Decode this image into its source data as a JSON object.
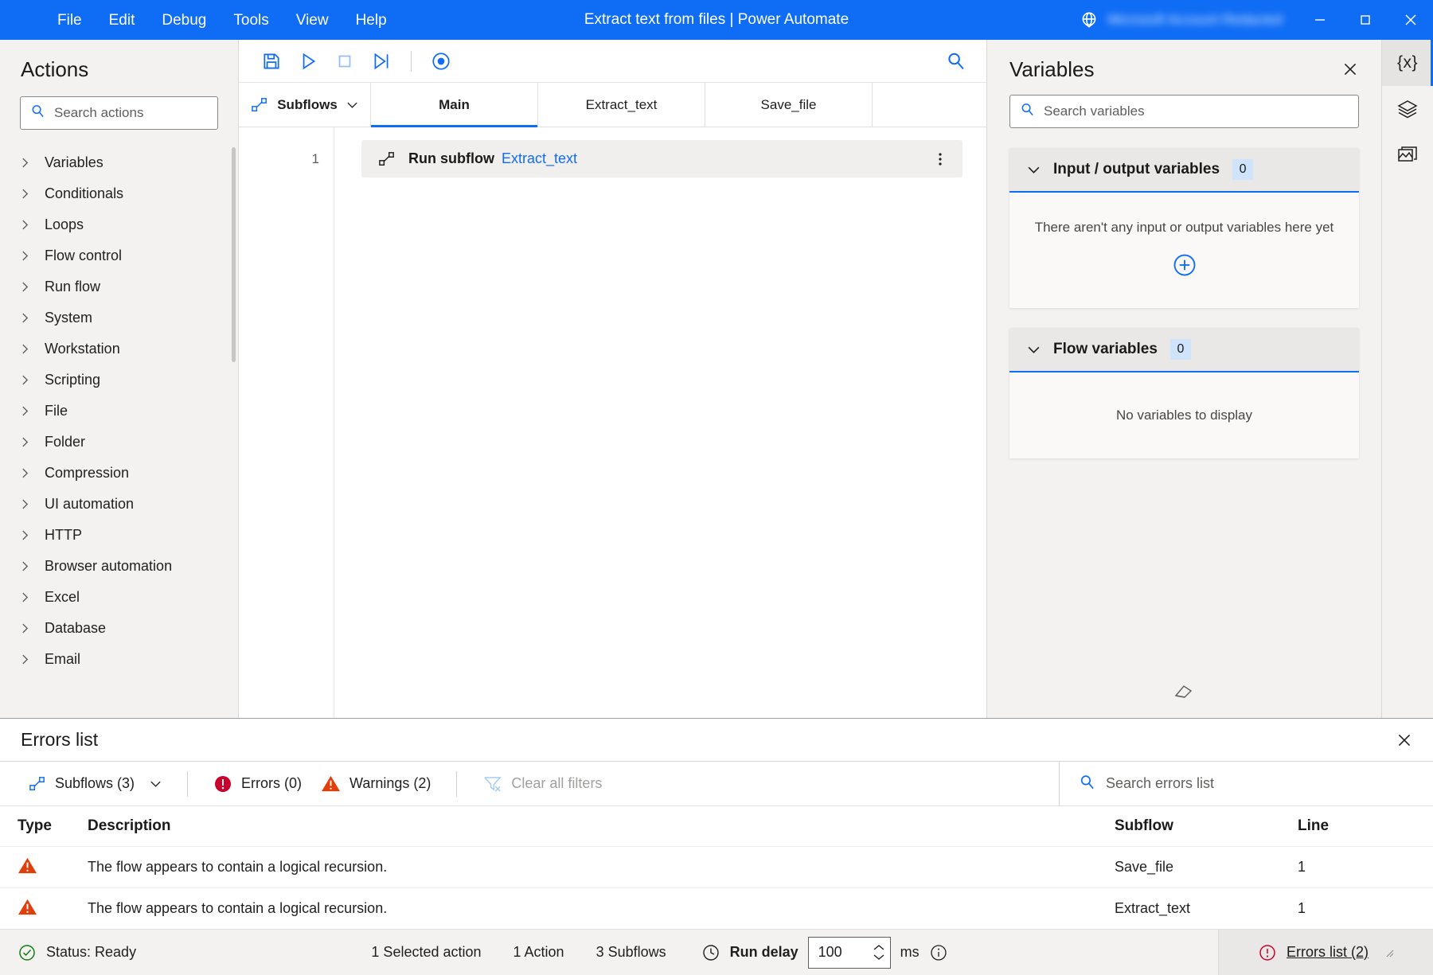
{
  "titlebar": {
    "menus": [
      "File",
      "Edit",
      "Debug",
      "Tools",
      "View",
      "Help"
    ],
    "title": "Extract text from files | Power Automate",
    "account_name": "Microsoft Account Redacted",
    "globe_icon": "globe-icon",
    "minimize_icon": "minimize-icon",
    "maximize_icon": "maximize-icon",
    "close_icon": "close-icon",
    "accent_color": "#0f6cf5"
  },
  "actions_panel": {
    "title": "Actions",
    "search_placeholder": "Search actions",
    "search_value": "",
    "search_icon": "search-icon",
    "groups": [
      "Variables",
      "Conditionals",
      "Loops",
      "Flow control",
      "Run flow",
      "System",
      "Workstation",
      "Scripting",
      "File",
      "Folder",
      "Compression",
      "UI automation",
      "HTTP",
      "Browser automation",
      "Excel",
      "Database",
      "Email"
    ]
  },
  "toolbar": {
    "buttons": [
      {
        "name": "save-button",
        "icon": "save-icon",
        "enabled": true
      },
      {
        "name": "run-button",
        "icon": "play-icon",
        "enabled": true
      },
      {
        "name": "stop-button",
        "icon": "stop-icon",
        "enabled": false
      },
      {
        "name": "run-next-action-button",
        "icon": "step-next-icon",
        "enabled": true
      },
      {
        "name": "recorder-button",
        "icon": "record-icon",
        "enabled": true
      }
    ],
    "search_icon": "search-icon"
  },
  "tabs": {
    "subflows_label": "Subflows",
    "subflows_icon": "subflow-icon",
    "chevron_icon": "chevron-down-icon",
    "items": [
      {
        "label": "Main",
        "active": true
      },
      {
        "label": "Extract_text",
        "active": false
      },
      {
        "label": "Save_file",
        "active": false
      }
    ]
  },
  "canvas": {
    "rows": [
      {
        "line": "1",
        "icon": "subflow-icon",
        "label": "Run subflow",
        "argument": "Extract_text",
        "menu_icon": "kebab-menu-icon"
      }
    ]
  },
  "variables_panel": {
    "title": "Variables",
    "close_icon": "close-icon",
    "search_placeholder": "Search variables",
    "search_value": "",
    "search_icon": "search-icon",
    "sections": [
      {
        "title": "Input / output variables",
        "count": "0",
        "empty_text": "There aren't any input or output variables here yet",
        "has_add": true,
        "add_icon": "add-circle-icon",
        "chevron_icon": "chevron-down-icon"
      },
      {
        "title": "Flow variables",
        "count": "0",
        "empty_text": "No variables to display",
        "has_add": false,
        "chevron_icon": "chevron-down-icon"
      }
    ],
    "footer_icon": "eraser-icon"
  },
  "rail": {
    "items": [
      {
        "name": "variables-pane-button",
        "glyph": "{x}",
        "icon": "variables-icon",
        "active": true
      },
      {
        "name": "ui-elements-pane-button",
        "glyph": "",
        "icon": "layers-icon",
        "active": false
      },
      {
        "name": "images-pane-button",
        "glyph": "",
        "icon": "images-icon",
        "active": false
      }
    ]
  },
  "errors_list": {
    "title": "Errors list",
    "close_icon": "close-icon",
    "filters": {
      "subflows_label": "Subflows (3)",
      "subflows_icon": "subflow-icon",
      "chevron_icon": "chevron-down-icon",
      "errors_label": "Errors (0)",
      "errors_icon": "error-icon",
      "warnings_label": "Warnings (2)",
      "warnings_icon": "warning-icon",
      "clear_filters_label": "Clear all filters",
      "clear_filters_icon": "filter-clear-icon"
    },
    "search_placeholder": "Search errors list",
    "search_value": "",
    "search_icon": "search-icon",
    "columns": [
      "Type",
      "Description",
      "Subflow",
      "Line"
    ],
    "rows": [
      {
        "type_icon": "warning-icon",
        "description": "The flow appears to contain a logical recursion.",
        "subflow": "Save_file",
        "line": "1"
      },
      {
        "type_icon": "warning-icon",
        "description": "The flow appears to contain a logical recursion.",
        "subflow": "Extract_text",
        "line": "1"
      }
    ]
  },
  "statusbar": {
    "status_icon": "check-circle-icon",
    "status_text": "Status: Ready",
    "selected_action_text": "1 Selected action",
    "action_count_text": "1 Action",
    "subflow_count_text": "3 Subflows",
    "run_delay_icon": "clock-icon",
    "run_delay_label": "Run delay",
    "run_delay_value": "100",
    "run_delay_unit": "ms",
    "info_icon": "info-icon",
    "errors_link_icon": "error-icon",
    "errors_link_text": "Errors list (2)"
  }
}
